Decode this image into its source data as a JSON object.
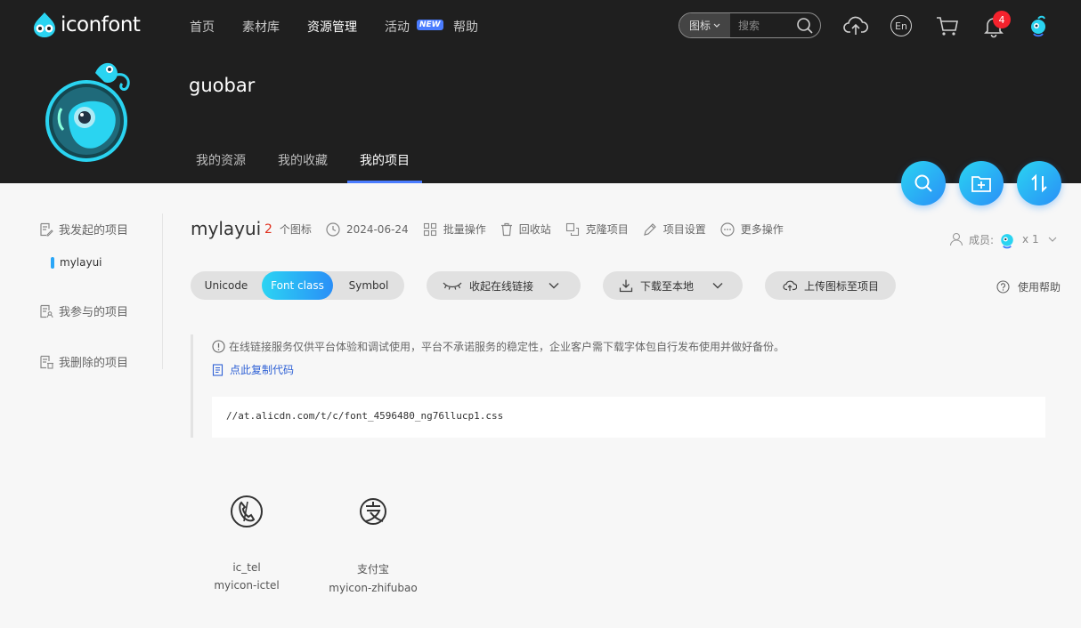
{
  "header": {
    "logo_text": "iconfont",
    "nav": [
      "首页",
      "素材库",
      "资源管理",
      "活动",
      "帮助"
    ],
    "nav_active_index": 2,
    "new_badge": "NEW",
    "search": {
      "type_label": "图标",
      "placeholder": "搜索"
    },
    "notification_count": "4",
    "language_icon": "En"
  },
  "profile": {
    "username": "guobar",
    "tabs": [
      "我的资源",
      "我的收藏",
      "我的项目"
    ],
    "active_tab_index": 2
  },
  "sidebar": {
    "items": [
      "我发起的项目",
      "我参与的项目",
      "我删除的项目"
    ],
    "sub_item": "mylayui"
  },
  "project": {
    "name": "mylayui",
    "icon_count": "2",
    "icon_count_label": "个图标",
    "date": "2024-06-24",
    "actions": [
      "批量操作",
      "回收站",
      "克隆项目",
      "项目设置",
      "更多操作"
    ],
    "members_label": "成员:",
    "members_count": "x 1"
  },
  "toolbar": {
    "segments": [
      "Unicode",
      "Font class",
      "Symbol"
    ],
    "active_segment": 1,
    "collapse_link_label": "收起在线链接",
    "download_label": "下载至本地",
    "upload_label": "上传图标至项目",
    "help_label": "使用帮助"
  },
  "notice": {
    "text": "在线链接服务仅供平台体验和调试使用，平台不承诺服务的稳定性，企业客户需下载字体包自行发布使用并做好备份。",
    "copy_label": "点此复制代码",
    "code_url": "//at.alicdn.com/t/c/font_4596480_ng76llucp1.css"
  },
  "icons": [
    {
      "name": "ic_tel",
      "class": "myicon-ictel",
      "icon": "phone-icon"
    },
    {
      "name": "支付宝",
      "class": "myicon-zhifubao",
      "icon": "alipay-icon"
    }
  ],
  "colors": {
    "header_bg": "#1f1f1f",
    "accent": "#2a8ff7",
    "accent_light": "#2bd4f3",
    "count_red": "#e0301e",
    "link_blue": "#2f61d5"
  }
}
